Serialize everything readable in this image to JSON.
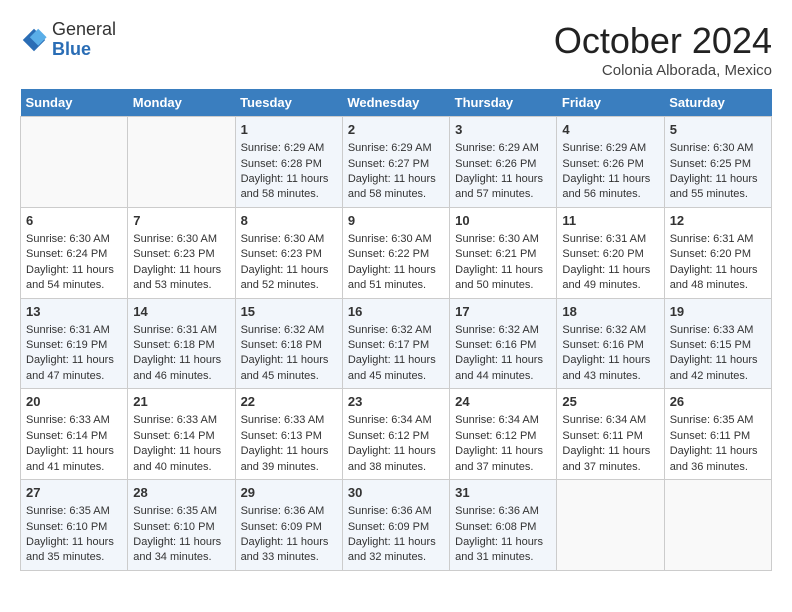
{
  "header": {
    "logo_line1": "General",
    "logo_line2": "Blue",
    "month": "October 2024",
    "location": "Colonia Alborada, Mexico"
  },
  "days_of_week": [
    "Sunday",
    "Monday",
    "Tuesday",
    "Wednesday",
    "Thursday",
    "Friday",
    "Saturday"
  ],
  "weeks": [
    [
      {
        "day": "",
        "content": ""
      },
      {
        "day": "",
        "content": ""
      },
      {
        "day": "1",
        "content": "Sunrise: 6:29 AM\nSunset: 6:28 PM\nDaylight: 11 hours and 58 minutes."
      },
      {
        "day": "2",
        "content": "Sunrise: 6:29 AM\nSunset: 6:27 PM\nDaylight: 11 hours and 58 minutes."
      },
      {
        "day": "3",
        "content": "Sunrise: 6:29 AM\nSunset: 6:26 PM\nDaylight: 11 hours and 57 minutes."
      },
      {
        "day": "4",
        "content": "Sunrise: 6:29 AM\nSunset: 6:26 PM\nDaylight: 11 hours and 56 minutes."
      },
      {
        "day": "5",
        "content": "Sunrise: 6:30 AM\nSunset: 6:25 PM\nDaylight: 11 hours and 55 minutes."
      }
    ],
    [
      {
        "day": "6",
        "content": "Sunrise: 6:30 AM\nSunset: 6:24 PM\nDaylight: 11 hours and 54 minutes."
      },
      {
        "day": "7",
        "content": "Sunrise: 6:30 AM\nSunset: 6:23 PM\nDaylight: 11 hours and 53 minutes."
      },
      {
        "day": "8",
        "content": "Sunrise: 6:30 AM\nSunset: 6:23 PM\nDaylight: 11 hours and 52 minutes."
      },
      {
        "day": "9",
        "content": "Sunrise: 6:30 AM\nSunset: 6:22 PM\nDaylight: 11 hours and 51 minutes."
      },
      {
        "day": "10",
        "content": "Sunrise: 6:30 AM\nSunset: 6:21 PM\nDaylight: 11 hours and 50 minutes."
      },
      {
        "day": "11",
        "content": "Sunrise: 6:31 AM\nSunset: 6:20 PM\nDaylight: 11 hours and 49 minutes."
      },
      {
        "day": "12",
        "content": "Sunrise: 6:31 AM\nSunset: 6:20 PM\nDaylight: 11 hours and 48 minutes."
      }
    ],
    [
      {
        "day": "13",
        "content": "Sunrise: 6:31 AM\nSunset: 6:19 PM\nDaylight: 11 hours and 47 minutes."
      },
      {
        "day": "14",
        "content": "Sunrise: 6:31 AM\nSunset: 6:18 PM\nDaylight: 11 hours and 46 minutes."
      },
      {
        "day": "15",
        "content": "Sunrise: 6:32 AM\nSunset: 6:18 PM\nDaylight: 11 hours and 45 minutes."
      },
      {
        "day": "16",
        "content": "Sunrise: 6:32 AM\nSunset: 6:17 PM\nDaylight: 11 hours and 45 minutes."
      },
      {
        "day": "17",
        "content": "Sunrise: 6:32 AM\nSunset: 6:16 PM\nDaylight: 11 hours and 44 minutes."
      },
      {
        "day": "18",
        "content": "Sunrise: 6:32 AM\nSunset: 6:16 PM\nDaylight: 11 hours and 43 minutes."
      },
      {
        "day": "19",
        "content": "Sunrise: 6:33 AM\nSunset: 6:15 PM\nDaylight: 11 hours and 42 minutes."
      }
    ],
    [
      {
        "day": "20",
        "content": "Sunrise: 6:33 AM\nSunset: 6:14 PM\nDaylight: 11 hours and 41 minutes."
      },
      {
        "day": "21",
        "content": "Sunrise: 6:33 AM\nSunset: 6:14 PM\nDaylight: 11 hours and 40 minutes."
      },
      {
        "day": "22",
        "content": "Sunrise: 6:33 AM\nSunset: 6:13 PM\nDaylight: 11 hours and 39 minutes."
      },
      {
        "day": "23",
        "content": "Sunrise: 6:34 AM\nSunset: 6:12 PM\nDaylight: 11 hours and 38 minutes."
      },
      {
        "day": "24",
        "content": "Sunrise: 6:34 AM\nSunset: 6:12 PM\nDaylight: 11 hours and 37 minutes."
      },
      {
        "day": "25",
        "content": "Sunrise: 6:34 AM\nSunset: 6:11 PM\nDaylight: 11 hours and 37 minutes."
      },
      {
        "day": "26",
        "content": "Sunrise: 6:35 AM\nSunset: 6:11 PM\nDaylight: 11 hours and 36 minutes."
      }
    ],
    [
      {
        "day": "27",
        "content": "Sunrise: 6:35 AM\nSunset: 6:10 PM\nDaylight: 11 hours and 35 minutes."
      },
      {
        "day": "28",
        "content": "Sunrise: 6:35 AM\nSunset: 6:10 PM\nDaylight: 11 hours and 34 minutes."
      },
      {
        "day": "29",
        "content": "Sunrise: 6:36 AM\nSunset: 6:09 PM\nDaylight: 11 hours and 33 minutes."
      },
      {
        "day": "30",
        "content": "Sunrise: 6:36 AM\nSunset: 6:09 PM\nDaylight: 11 hours and 32 minutes."
      },
      {
        "day": "31",
        "content": "Sunrise: 6:36 AM\nSunset: 6:08 PM\nDaylight: 11 hours and 31 minutes."
      },
      {
        "day": "",
        "content": ""
      },
      {
        "day": "",
        "content": ""
      }
    ]
  ]
}
